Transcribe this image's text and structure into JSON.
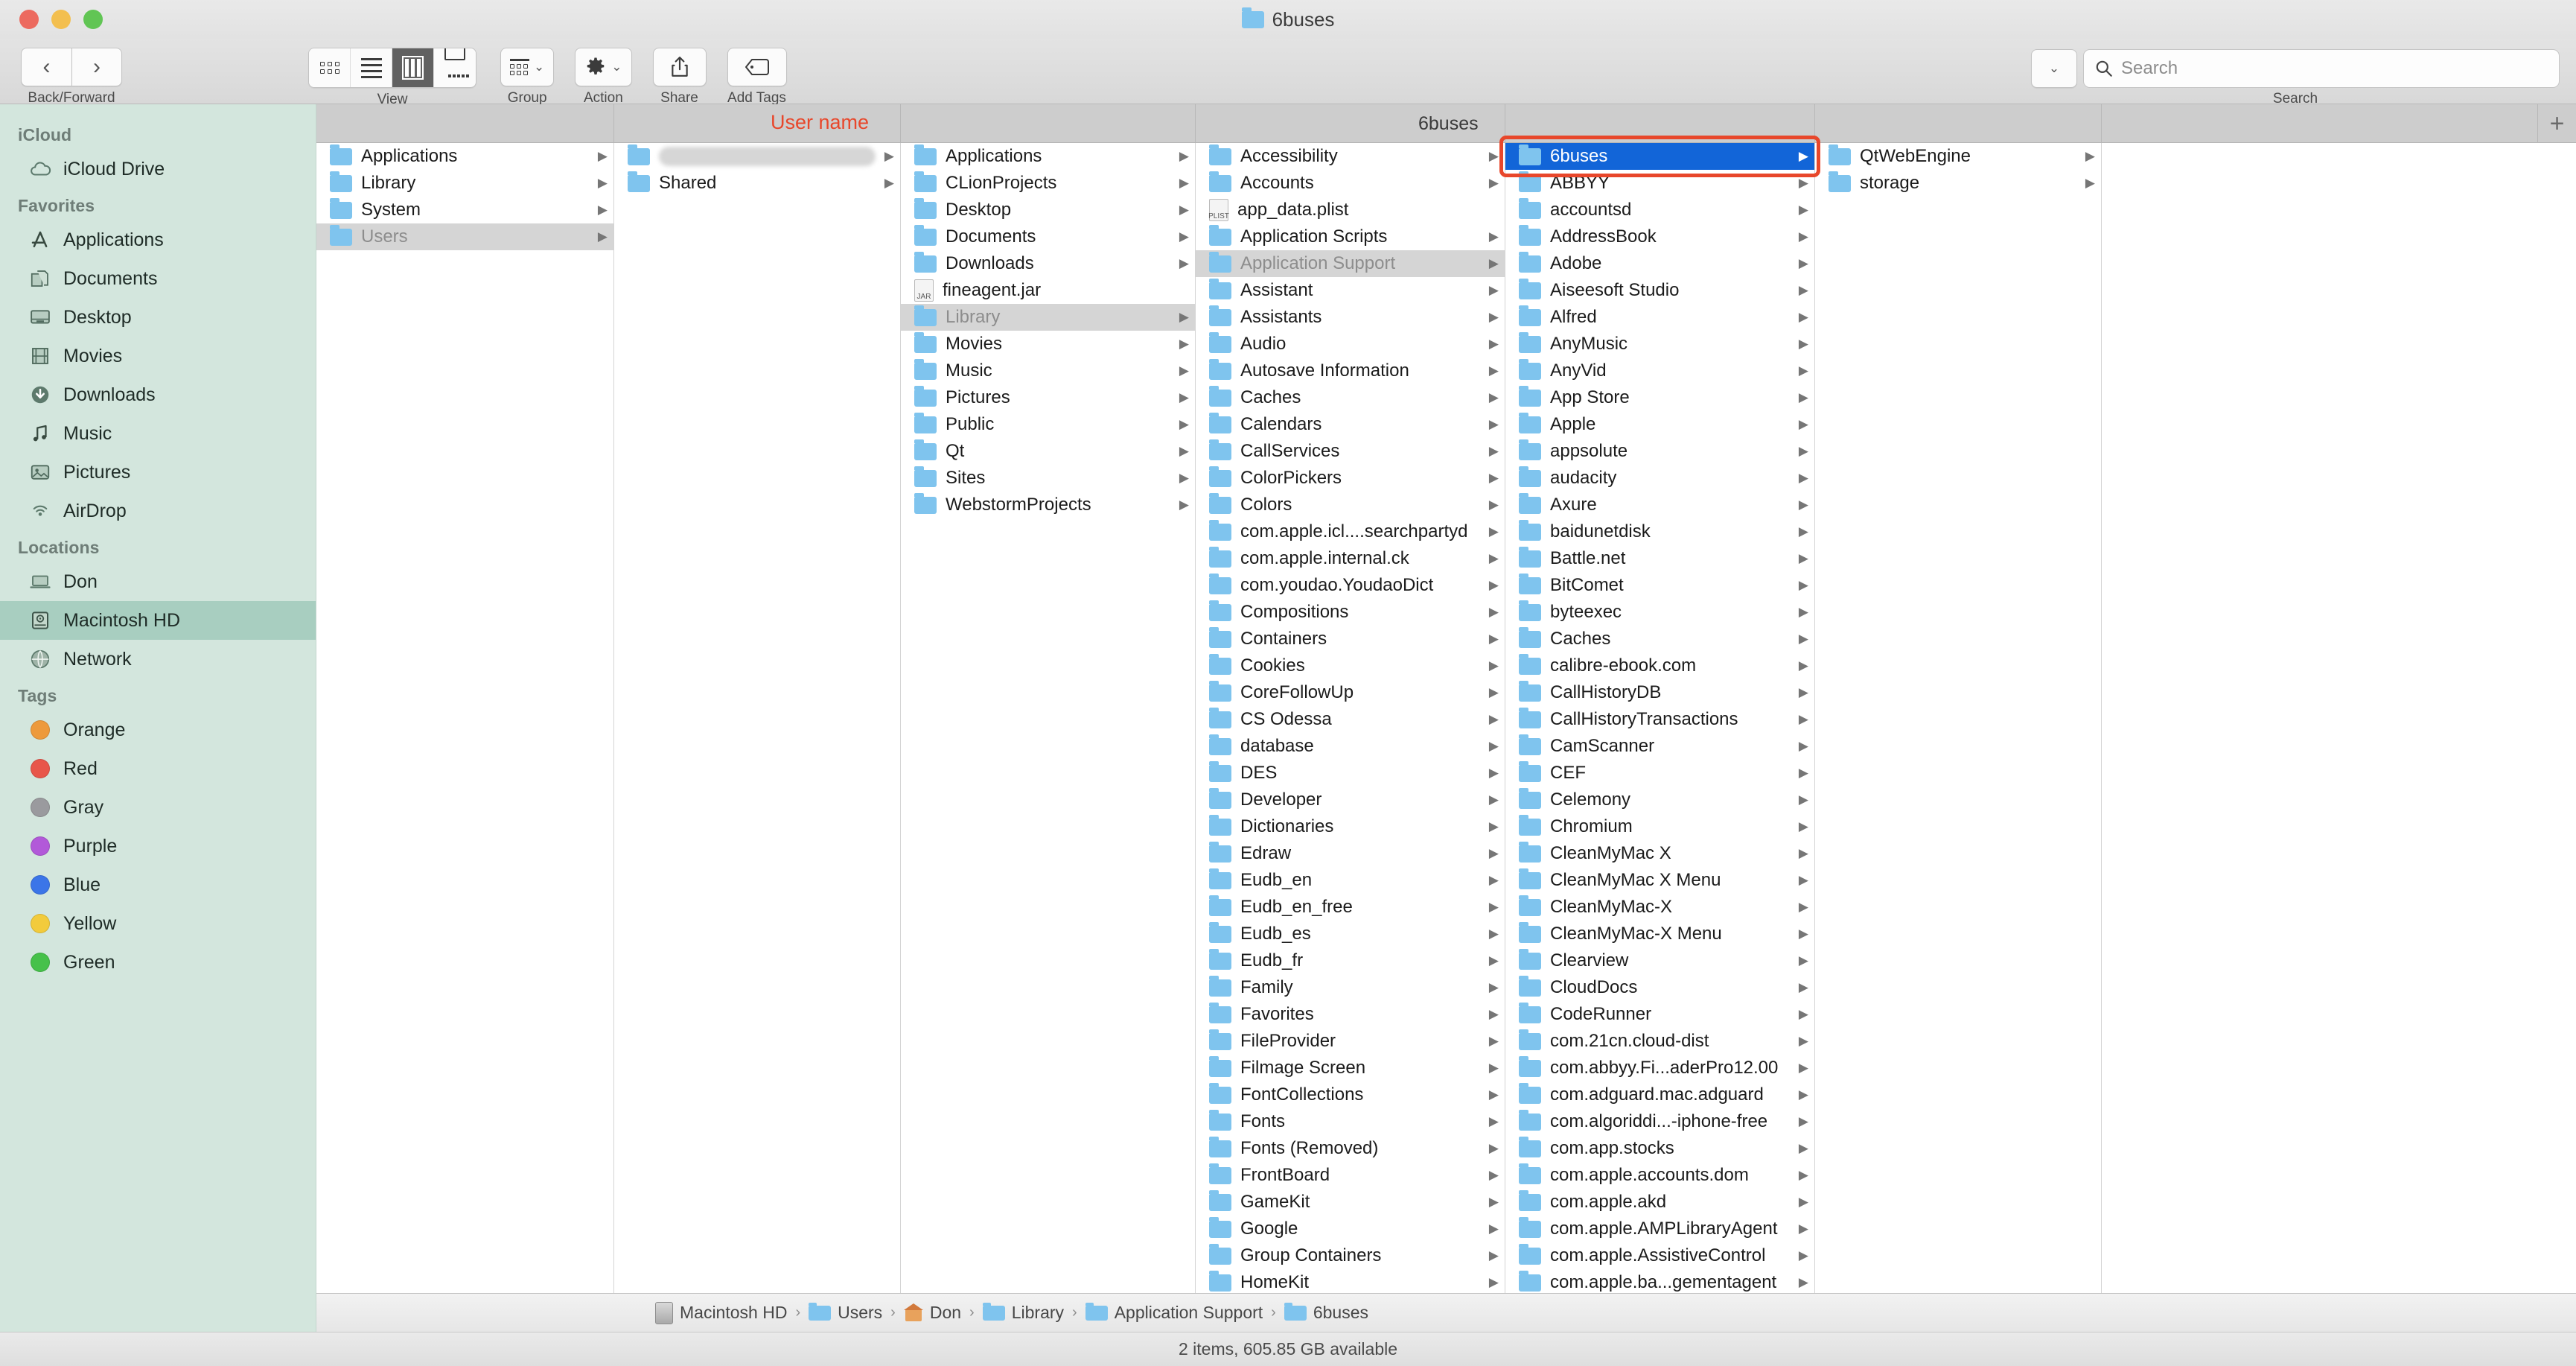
{
  "window": {
    "title": "6buses",
    "traffic_lights": [
      "close",
      "minimize",
      "zoom"
    ]
  },
  "toolbar": {
    "nav": {
      "caption": "Back/Forward",
      "back": "‹",
      "forward": "›"
    },
    "view": {
      "caption": "View",
      "modes": [
        "icon-view",
        "list-view",
        "column-view",
        "gallery-view"
      ],
      "active": "column-view"
    },
    "group": {
      "caption": "Group"
    },
    "action": {
      "caption": "Action"
    },
    "share": {
      "caption": "Share"
    },
    "add_tags": {
      "caption": "Add Tags"
    },
    "search": {
      "caption": "Search",
      "placeholder": "Search",
      "value": ""
    }
  },
  "sidebar": {
    "sections": [
      {
        "header": "iCloud",
        "items": [
          {
            "label": "iCloud Drive",
            "icon": "cloud-icon",
            "selected": false
          }
        ]
      },
      {
        "header": "Favorites",
        "items": [
          {
            "label": "Applications",
            "icon": "applications-icon",
            "selected": false
          },
          {
            "label": "Documents",
            "icon": "documents-icon",
            "selected": false
          },
          {
            "label": "Desktop",
            "icon": "desktop-icon",
            "selected": false
          },
          {
            "label": "Movies",
            "icon": "movies-icon",
            "selected": false
          },
          {
            "label": "Downloads",
            "icon": "downloads-icon",
            "selected": false
          },
          {
            "label": "Music",
            "icon": "music-icon",
            "selected": false
          },
          {
            "label": "Pictures",
            "icon": "pictures-icon",
            "selected": false
          },
          {
            "label": "AirDrop",
            "icon": "airdrop-icon",
            "selected": false
          }
        ]
      },
      {
        "header": "Locations",
        "items": [
          {
            "label": "Don",
            "icon": "laptop-icon",
            "selected": false
          },
          {
            "label": "Macintosh HD",
            "icon": "harddisk-icon",
            "selected": true
          },
          {
            "label": "Network",
            "icon": "network-globe-icon",
            "selected": false
          }
        ]
      },
      {
        "header": "Tags",
        "items": [
          {
            "label": "Orange",
            "icon": "tag-dot-icon",
            "color": "#ed9a3c"
          },
          {
            "label": "Red",
            "icon": "tag-dot-icon",
            "color": "#e8564a"
          },
          {
            "label": "Gray",
            "icon": "tag-dot-icon",
            "color": "#9a9a9e"
          },
          {
            "label": "Purple",
            "icon": "tag-dot-icon",
            "color": "#b259d9"
          },
          {
            "label": "Blue",
            "icon": "tag-dot-icon",
            "color": "#3b75e8"
          },
          {
            "label": "Yellow",
            "icon": "tag-dot-icon",
            "color": "#f2cb3c"
          },
          {
            "label": "Green",
            "icon": "tag-dot-icon",
            "color": "#46c14a"
          }
        ]
      }
    ]
  },
  "column_header": {
    "annotation": "User name",
    "current_folder": "6buses"
  },
  "columns": [
    {
      "id": "col-1",
      "items": [
        {
          "name": "Applications",
          "kind": "folder",
          "arrow": true,
          "state": "none"
        },
        {
          "name": "Library",
          "kind": "folder",
          "arrow": true,
          "state": "none"
        },
        {
          "name": "System",
          "kind": "folder",
          "arrow": true,
          "state": "none"
        },
        {
          "name": "Users",
          "kind": "folder",
          "arrow": true,
          "state": "selected-inactive"
        }
      ]
    },
    {
      "id": "col-2",
      "items": [
        {
          "name": "",
          "kind": "folder",
          "arrow": true,
          "state": "redacted"
        },
        {
          "name": "Shared",
          "kind": "folder",
          "arrow": true,
          "state": "none"
        }
      ]
    },
    {
      "id": "col-3",
      "items": [
        {
          "name": "Applications",
          "kind": "folder",
          "arrow": true,
          "state": "none"
        },
        {
          "name": "CLionProjects",
          "kind": "folder",
          "arrow": true,
          "state": "none"
        },
        {
          "name": "Desktop",
          "kind": "folder",
          "arrow": true,
          "state": "none"
        },
        {
          "name": "Documents",
          "kind": "folder",
          "arrow": true,
          "state": "none"
        },
        {
          "name": "Downloads",
          "kind": "folder",
          "arrow": true,
          "state": "none"
        },
        {
          "name": "fineagent.jar",
          "kind": "file-jar",
          "arrow": false,
          "state": "none"
        },
        {
          "name": "Library",
          "kind": "folder",
          "arrow": true,
          "state": "selected-inactive"
        },
        {
          "name": "Movies",
          "kind": "folder",
          "arrow": true,
          "state": "none"
        },
        {
          "name": "Music",
          "kind": "folder",
          "arrow": true,
          "state": "none"
        },
        {
          "name": "Pictures",
          "kind": "folder",
          "arrow": true,
          "state": "none"
        },
        {
          "name": "Public",
          "kind": "folder",
          "arrow": true,
          "state": "none"
        },
        {
          "name": "Qt",
          "kind": "folder",
          "arrow": true,
          "state": "none"
        },
        {
          "name": "Sites",
          "kind": "folder",
          "arrow": true,
          "state": "none"
        },
        {
          "name": "WebstormProjects",
          "kind": "folder",
          "arrow": true,
          "state": "none"
        }
      ]
    },
    {
      "id": "col-4",
      "items": [
        {
          "name": "Accessibility",
          "kind": "folder",
          "arrow": true,
          "state": "none"
        },
        {
          "name": "Accounts",
          "kind": "folder",
          "arrow": true,
          "state": "none"
        },
        {
          "name": "app_data.plist",
          "kind": "file-plist",
          "arrow": false,
          "state": "none"
        },
        {
          "name": "Application Scripts",
          "kind": "folder",
          "arrow": true,
          "state": "none"
        },
        {
          "name": "Application Support",
          "kind": "folder",
          "arrow": true,
          "state": "selected-inactive"
        },
        {
          "name": "Assistant",
          "kind": "folder",
          "arrow": true,
          "state": "none"
        },
        {
          "name": "Assistants",
          "kind": "folder",
          "arrow": true,
          "state": "none"
        },
        {
          "name": "Audio",
          "kind": "folder",
          "arrow": true,
          "state": "none"
        },
        {
          "name": "Autosave Information",
          "kind": "folder",
          "arrow": true,
          "state": "none"
        },
        {
          "name": "Caches",
          "kind": "folder",
          "arrow": true,
          "state": "none"
        },
        {
          "name": "Calendars",
          "kind": "folder",
          "arrow": true,
          "state": "none"
        },
        {
          "name": "CallServices",
          "kind": "folder",
          "arrow": true,
          "state": "none"
        },
        {
          "name": "ColorPickers",
          "kind": "folder",
          "arrow": true,
          "state": "none"
        },
        {
          "name": "Colors",
          "kind": "folder",
          "arrow": true,
          "state": "none"
        },
        {
          "name": "com.apple.icl....searchpartyd",
          "kind": "folder",
          "arrow": true,
          "state": "none"
        },
        {
          "name": "com.apple.internal.ck",
          "kind": "folder",
          "arrow": true,
          "state": "none"
        },
        {
          "name": "com.youdao.YoudaoDict",
          "kind": "folder",
          "arrow": true,
          "state": "none"
        },
        {
          "name": "Compositions",
          "kind": "folder",
          "arrow": true,
          "state": "none"
        },
        {
          "name": "Containers",
          "kind": "folder",
          "arrow": true,
          "state": "none"
        },
        {
          "name": "Cookies",
          "kind": "folder",
          "arrow": true,
          "state": "none"
        },
        {
          "name": "CoreFollowUp",
          "kind": "folder",
          "arrow": true,
          "state": "none"
        },
        {
          "name": "CS Odessa",
          "kind": "folder",
          "arrow": true,
          "state": "none"
        },
        {
          "name": "database",
          "kind": "folder",
          "arrow": true,
          "state": "none"
        },
        {
          "name": "DES",
          "kind": "folder",
          "arrow": true,
          "state": "none"
        },
        {
          "name": "Developer",
          "kind": "folder",
          "arrow": true,
          "state": "none"
        },
        {
          "name": "Dictionaries",
          "kind": "folder",
          "arrow": true,
          "state": "none"
        },
        {
          "name": "Edraw",
          "kind": "folder",
          "arrow": true,
          "state": "none"
        },
        {
          "name": "Eudb_en",
          "kind": "folder",
          "arrow": true,
          "state": "none"
        },
        {
          "name": "Eudb_en_free",
          "kind": "folder",
          "arrow": true,
          "state": "none"
        },
        {
          "name": "Eudb_es",
          "kind": "folder",
          "arrow": true,
          "state": "none"
        },
        {
          "name": "Eudb_fr",
          "kind": "folder",
          "arrow": true,
          "state": "none"
        },
        {
          "name": "Family",
          "kind": "folder",
          "arrow": true,
          "state": "none"
        },
        {
          "name": "Favorites",
          "kind": "folder",
          "arrow": true,
          "state": "none"
        },
        {
          "name": "FileProvider",
          "kind": "folder",
          "arrow": true,
          "state": "none"
        },
        {
          "name": "Filmage Screen",
          "kind": "folder",
          "arrow": true,
          "state": "none"
        },
        {
          "name": "FontCollections",
          "kind": "folder",
          "arrow": true,
          "state": "none"
        },
        {
          "name": "Fonts",
          "kind": "folder",
          "arrow": true,
          "state": "none"
        },
        {
          "name": "Fonts (Removed)",
          "kind": "folder",
          "arrow": true,
          "state": "none"
        },
        {
          "name": "FrontBoard",
          "kind": "folder",
          "arrow": true,
          "state": "none"
        },
        {
          "name": "GameKit",
          "kind": "folder",
          "arrow": true,
          "state": "none"
        },
        {
          "name": "Google",
          "kind": "folder",
          "arrow": true,
          "state": "none"
        },
        {
          "name": "Group Containers",
          "kind": "folder",
          "arrow": true,
          "state": "none"
        },
        {
          "name": "HomeKit",
          "kind": "folder",
          "arrow": true,
          "state": "none"
        }
      ]
    },
    {
      "id": "col-5",
      "items": [
        {
          "name": "6buses",
          "kind": "folder",
          "arrow": true,
          "state": "selected-active"
        },
        {
          "name": "ABBYY",
          "kind": "folder",
          "arrow": true,
          "state": "none"
        },
        {
          "name": "accountsd",
          "kind": "folder",
          "arrow": true,
          "state": "none"
        },
        {
          "name": "AddressBook",
          "kind": "folder",
          "arrow": true,
          "state": "none"
        },
        {
          "name": "Adobe",
          "kind": "folder",
          "arrow": true,
          "state": "none"
        },
        {
          "name": "Aiseesoft Studio",
          "kind": "folder",
          "arrow": true,
          "state": "none"
        },
        {
          "name": "Alfred",
          "kind": "folder",
          "arrow": true,
          "state": "none"
        },
        {
          "name": "AnyMusic",
          "kind": "folder",
          "arrow": true,
          "state": "none"
        },
        {
          "name": "AnyVid",
          "kind": "folder",
          "arrow": true,
          "state": "none"
        },
        {
          "name": "App Store",
          "kind": "folder",
          "arrow": true,
          "state": "none"
        },
        {
          "name": "Apple",
          "kind": "folder",
          "arrow": true,
          "state": "none"
        },
        {
          "name": "appsolute",
          "kind": "folder",
          "arrow": true,
          "state": "none"
        },
        {
          "name": "audacity",
          "kind": "folder",
          "arrow": true,
          "state": "none"
        },
        {
          "name": "Axure",
          "kind": "folder",
          "arrow": true,
          "state": "none"
        },
        {
          "name": "baidunetdisk",
          "kind": "folder",
          "arrow": true,
          "state": "none"
        },
        {
          "name": "Battle.net",
          "kind": "folder",
          "arrow": true,
          "state": "none"
        },
        {
          "name": "BitComet",
          "kind": "folder",
          "arrow": true,
          "state": "none"
        },
        {
          "name": "byteexec",
          "kind": "folder",
          "arrow": true,
          "state": "none"
        },
        {
          "name": "Caches",
          "kind": "folder",
          "arrow": true,
          "state": "none"
        },
        {
          "name": "calibre-ebook.com",
          "kind": "folder",
          "arrow": true,
          "state": "none"
        },
        {
          "name": "CallHistoryDB",
          "kind": "folder",
          "arrow": true,
          "state": "none"
        },
        {
          "name": "CallHistoryTransactions",
          "kind": "folder",
          "arrow": true,
          "state": "none"
        },
        {
          "name": "CamScanner",
          "kind": "folder",
          "arrow": true,
          "state": "none"
        },
        {
          "name": "CEF",
          "kind": "folder",
          "arrow": true,
          "state": "none"
        },
        {
          "name": "Celemony",
          "kind": "folder",
          "arrow": true,
          "state": "none"
        },
        {
          "name": "Chromium",
          "kind": "folder",
          "arrow": true,
          "state": "none"
        },
        {
          "name": "CleanMyMac X",
          "kind": "folder",
          "arrow": true,
          "state": "none"
        },
        {
          "name": "CleanMyMac X Menu",
          "kind": "folder",
          "arrow": true,
          "state": "none"
        },
        {
          "name": "CleanMyMac-X",
          "kind": "folder",
          "arrow": true,
          "state": "none"
        },
        {
          "name": "CleanMyMac-X Menu",
          "kind": "folder",
          "arrow": true,
          "state": "none"
        },
        {
          "name": "Clearview",
          "kind": "folder",
          "arrow": true,
          "state": "none"
        },
        {
          "name": "CloudDocs",
          "kind": "folder",
          "arrow": true,
          "state": "none"
        },
        {
          "name": "CodeRunner",
          "kind": "folder",
          "arrow": true,
          "state": "none"
        },
        {
          "name": "com.21cn.cloud-dist",
          "kind": "folder",
          "arrow": true,
          "state": "none"
        },
        {
          "name": "com.abbyy.Fi...aderPro12.00",
          "kind": "folder",
          "arrow": true,
          "state": "none"
        },
        {
          "name": "com.adguard.mac.adguard",
          "kind": "folder",
          "arrow": true,
          "state": "none"
        },
        {
          "name": "com.algoriddi...-iphone-free",
          "kind": "folder",
          "arrow": true,
          "state": "none"
        },
        {
          "name": "com.app.stocks",
          "kind": "folder",
          "arrow": true,
          "state": "none"
        },
        {
          "name": "com.apple.accounts.dom",
          "kind": "folder",
          "arrow": true,
          "state": "none"
        },
        {
          "name": "com.apple.akd",
          "kind": "folder",
          "arrow": true,
          "state": "none"
        },
        {
          "name": "com.apple.AMPLibraryAgent",
          "kind": "folder",
          "arrow": true,
          "state": "none"
        },
        {
          "name": "com.apple.AssistiveControl",
          "kind": "folder",
          "arrow": true,
          "state": "none"
        },
        {
          "name": "com.apple.ba...gementagent",
          "kind": "folder",
          "arrow": true,
          "state": "none"
        }
      ]
    },
    {
      "id": "col-6",
      "items": [
        {
          "name": "QtWebEngine",
          "kind": "folder",
          "arrow": true,
          "state": "none"
        },
        {
          "name": "storage",
          "kind": "folder",
          "arrow": true,
          "state": "none"
        }
      ]
    }
  ],
  "path_bar": {
    "crumbs": [
      {
        "label": "Macintosh HD",
        "icon": "harddisk-icon"
      },
      {
        "label": "Users",
        "icon": "users-folder-icon"
      },
      {
        "label": "Don",
        "icon": "home-folder-icon"
      },
      {
        "label": "Library",
        "icon": "library-folder-icon"
      },
      {
        "label": "Application Support",
        "icon": "folder-icon"
      },
      {
        "label": "6buses",
        "icon": "folder-icon"
      }
    ],
    "separator": "›"
  },
  "status_bar": {
    "text": "2 items, 605.85 GB available"
  },
  "annotations": {
    "color": "#e8472b",
    "user_name_label": "User name",
    "highlight_target": "6buses"
  }
}
